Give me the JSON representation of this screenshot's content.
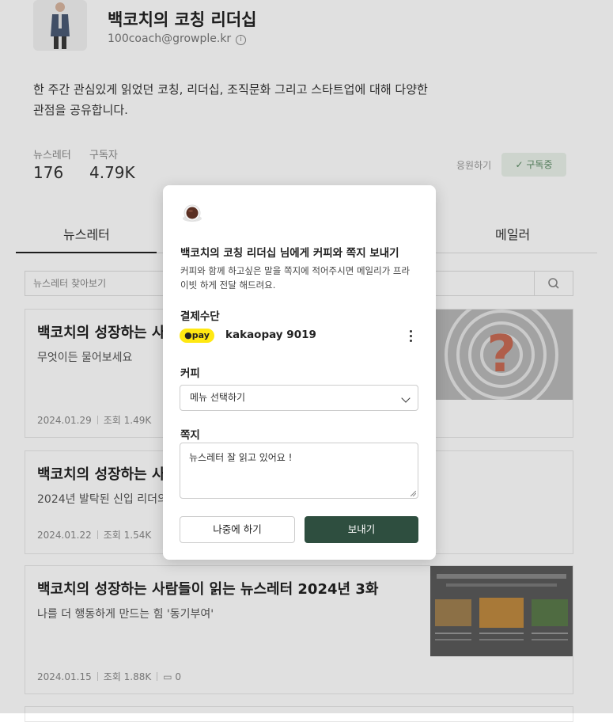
{
  "profile": {
    "name": "백코치의 코칭 리더십",
    "email": "100coach@growple.kr",
    "description": "한 주간 관심있게 읽었던 코칭, 리더십, 조직문화 그리고 스타트업에 대해 다양한 관점을 공유합니다."
  },
  "stats": {
    "newsletters_label": "뉴스레터",
    "newsletters_value": "176",
    "subscribers_label": "구독자",
    "subscribers_value": "4.79K",
    "support_label": "응원하기",
    "subscribed_label": "구독중"
  },
  "tabs": [
    "뉴스레터",
    "메일러"
  ],
  "search": {
    "placeholder": "뉴스레터 찾아보기"
  },
  "posts": [
    {
      "title": "백코치의 성장하는 사람들이 읽는 뉴스레터 2024년 5화",
      "title_visible": "백코치의 성장하는 사",
      "subtitle": "무엇이든 물어보세요",
      "date": "2024.01.29",
      "views": "조회 1.49K"
    },
    {
      "title": "백코치의 성장하는 사람들이 읽는 뉴스레터 2024년 4화",
      "title_visible": "백코치의 성장하는 사",
      "subtitle": "2024년 발탁된 신입 리더의",
      "subtitle_visible": "2024년 발탁된 신입 리더의",
      "date": "2024.01.22",
      "views": "조회 1.54K"
    },
    {
      "title": "백코치의 성장하는 사람들이 읽는 뉴스레터 2024년 3화",
      "subtitle": "나를 더 행동하게 만드는 힘 '동기부여'",
      "date": "2024.01.15",
      "views": "조회 1.88K",
      "comments": "0"
    }
  ],
  "modal": {
    "title": "백코치의 코칭 리더십 님에게 커피와 쪽지 보내기",
    "description": "커피와 함께 하고싶은 말을 쪽지에 적어주시면 메일리가 프라이빗 하게 전달 해드려요.",
    "payment_label": "결제수단",
    "pay_badge": "pay",
    "pay_method": "kakaopay 9019",
    "coffee_label": "커피",
    "coffee_select_value": "메뉴 선택하기",
    "note_label": "쪽지",
    "note_value": "뉴스레터 잘 읽고 있어요 !",
    "later_button": "나중에 하기",
    "send_button": "보내기"
  }
}
